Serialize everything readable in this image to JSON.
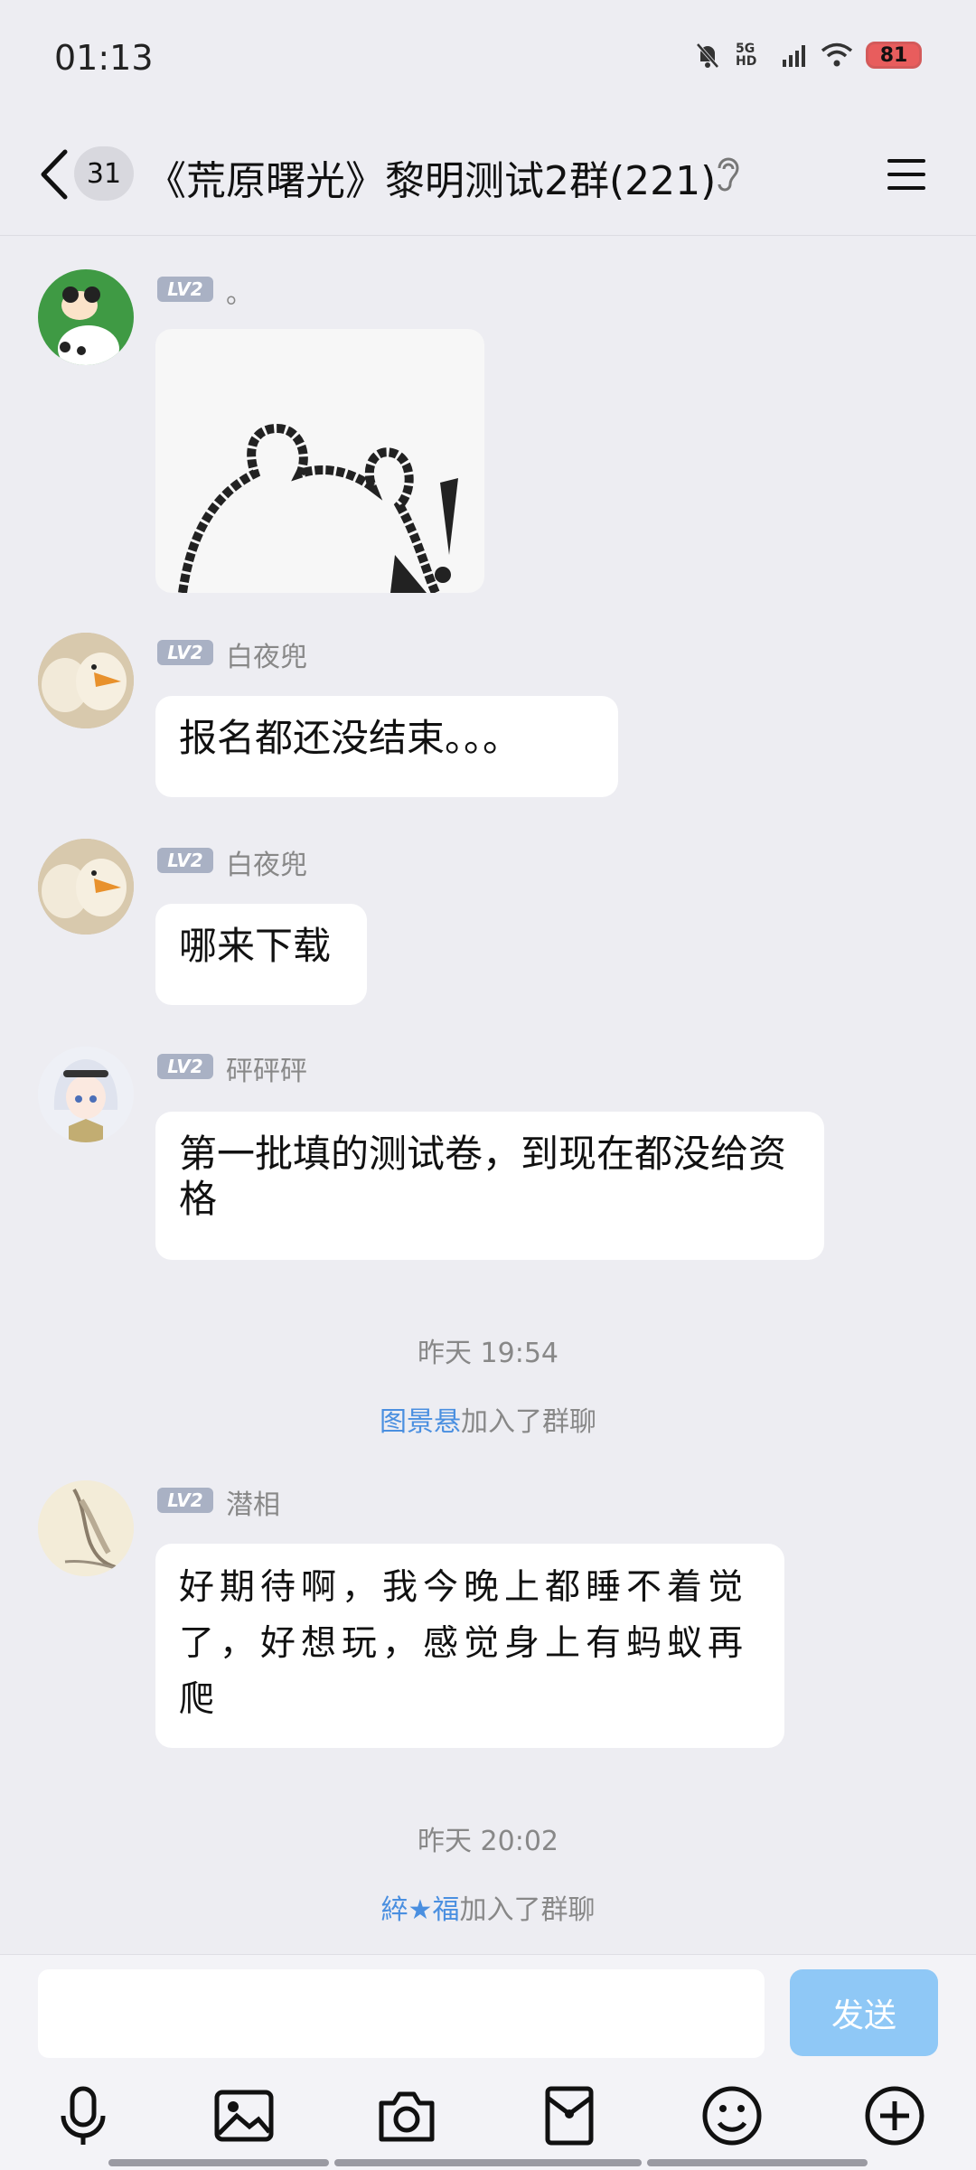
{
  "status": {
    "time": "01:13",
    "network": "5G HD",
    "battery": "81"
  },
  "header": {
    "unread_count": "31",
    "title": "《荒原曙光》黎明测试2群(221)"
  },
  "level_badge": "LV2",
  "messages": [
    {
      "type": "sticker",
      "sender": "。"
    },
    {
      "type": "text",
      "sender": "白夜兜",
      "text": "报名都还没结束。。。"
    },
    {
      "type": "text",
      "sender": "白夜兜",
      "text": "哪来下载"
    },
    {
      "type": "text",
      "sender": "砰砰砰",
      "text": "第一批填的测试卷，到现在都没给资格"
    },
    {
      "type": "time",
      "text": "昨天 19:54"
    },
    {
      "type": "system",
      "who": "图景悬",
      "suffix": "加入了群聊"
    },
    {
      "type": "text",
      "sender": "潜相",
      "text": "好期待啊，我今晚上都睡不着觉了，好想玩，感觉身上有蚂蚁再爬"
    },
    {
      "type": "time",
      "text": "昨天 20:02"
    },
    {
      "type": "system",
      "who": "綷★福",
      "suffix": "加入了群聊"
    }
  ],
  "input": {
    "placeholder": "",
    "send_label": "发送"
  },
  "tools": [
    "microphone-icon",
    "image-icon",
    "camera-icon",
    "red-packet-icon",
    "emoji-icon",
    "plus-icon"
  ],
  "colors": {
    "background": "#ededf2",
    "bubble": "#ffffff",
    "link": "#4a8fe0",
    "send": "#8fc8f6"
  }
}
